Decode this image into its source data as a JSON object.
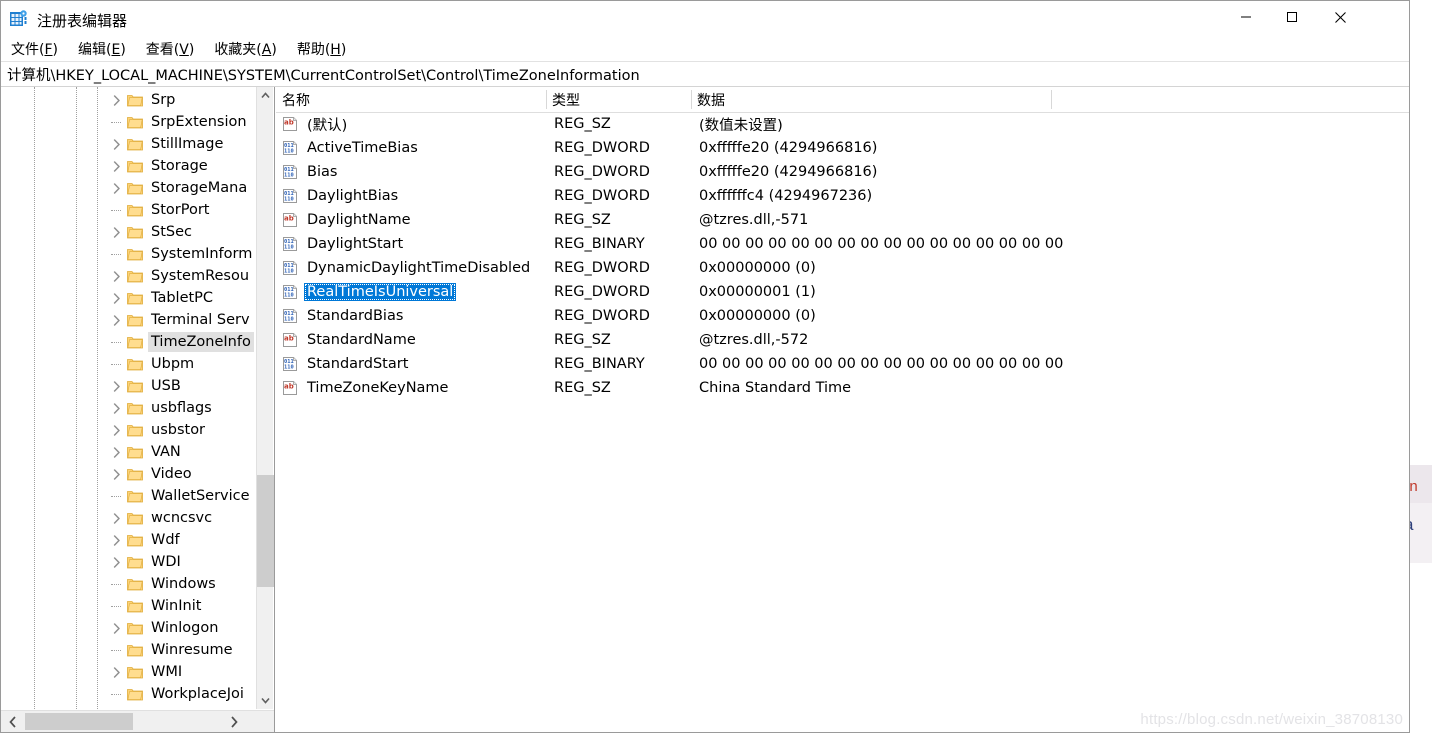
{
  "window": {
    "title": "注册表编辑器",
    "icon": "registry-icon",
    "controls": {
      "minimize": "—",
      "maximize": "□",
      "close": "✕"
    }
  },
  "menu": {
    "items": [
      {
        "label": "文件(F)",
        "text": "文件(",
        "accel": "F",
        "tail": ")"
      },
      {
        "label": "编辑(E)",
        "text": "编辑(",
        "accel": "E",
        "tail": ")"
      },
      {
        "label": "查看(V)",
        "text": "查看(",
        "accel": "V",
        "tail": ")"
      },
      {
        "label": "收藏夹(A)",
        "text": "收藏夹(",
        "accel": "A",
        "tail": ")"
      },
      {
        "label": "帮助(H)",
        "text": "帮助(",
        "accel": "H",
        "tail": ")"
      }
    ]
  },
  "address": {
    "path": "计算机\\HKEY_LOCAL_MACHINE\\SYSTEM\\CurrentControlSet\\Control\\TimeZoneInformation"
  },
  "tree": {
    "selected": "TimeZoneInfo",
    "items": [
      {
        "label": "Srp",
        "expandable": true,
        "selected": false
      },
      {
        "label": "SrpExtension",
        "expandable": false,
        "selected": false
      },
      {
        "label": "StillImage",
        "expandable": true,
        "selected": false
      },
      {
        "label": "Storage",
        "expandable": true,
        "selected": false
      },
      {
        "label": "StorageMana",
        "expandable": true,
        "selected": false
      },
      {
        "label": "StorPort",
        "expandable": false,
        "selected": false
      },
      {
        "label": "StSec",
        "expandable": true,
        "selected": false
      },
      {
        "label": "SystemInform",
        "expandable": false,
        "selected": false
      },
      {
        "label": "SystemResou",
        "expandable": true,
        "selected": false
      },
      {
        "label": "TabletPC",
        "expandable": true,
        "selected": false
      },
      {
        "label": "Terminal Serv",
        "expandable": true,
        "selected": false
      },
      {
        "label": "TimeZoneInfo",
        "expandable": false,
        "selected": true
      },
      {
        "label": "Ubpm",
        "expandable": false,
        "selected": false
      },
      {
        "label": "USB",
        "expandable": true,
        "selected": false
      },
      {
        "label": "usbflags",
        "expandable": true,
        "selected": false
      },
      {
        "label": "usbstor",
        "expandable": true,
        "selected": false
      },
      {
        "label": "VAN",
        "expandable": true,
        "selected": false
      },
      {
        "label": "Video",
        "expandable": true,
        "selected": false
      },
      {
        "label": "WalletService",
        "expandable": false,
        "selected": false
      },
      {
        "label": "wcncsvc",
        "expandable": true,
        "selected": false
      },
      {
        "label": "Wdf",
        "expandable": true,
        "selected": false
      },
      {
        "label": "WDI",
        "expandable": true,
        "selected": false
      },
      {
        "label": "Windows",
        "expandable": false,
        "selected": false
      },
      {
        "label": "WinInit",
        "expandable": false,
        "selected": false
      },
      {
        "label": "Winlogon",
        "expandable": true,
        "selected": false
      },
      {
        "label": "Winresume",
        "expandable": false,
        "selected": false
      },
      {
        "label": "WMI",
        "expandable": true,
        "selected": false
      },
      {
        "label": "WorkplaceJoi",
        "expandable": false,
        "selected": false
      }
    ]
  },
  "list": {
    "columns": [
      {
        "key": "name",
        "label": "名称"
      },
      {
        "key": "type",
        "label": "类型"
      },
      {
        "key": "data",
        "label": "数据"
      }
    ],
    "rows": [
      {
        "icon": "string-value-icon",
        "name": "(默认)",
        "type": "REG_SZ",
        "data": "(数值未设置)",
        "selected": false
      },
      {
        "icon": "dword-value-icon",
        "name": "ActiveTimeBias",
        "type": "REG_DWORD",
        "data": "0xfffffe20 (4294966816)",
        "selected": false
      },
      {
        "icon": "dword-value-icon",
        "name": "Bias",
        "type": "REG_DWORD",
        "data": "0xfffffe20 (4294966816)",
        "selected": false
      },
      {
        "icon": "dword-value-icon",
        "name": "DaylightBias",
        "type": "REG_DWORD",
        "data": "0xffffffc4 (4294967236)",
        "selected": false
      },
      {
        "icon": "string-value-icon",
        "name": "DaylightName",
        "type": "REG_SZ",
        "data": "@tzres.dll,-571",
        "selected": false
      },
      {
        "icon": "dword-value-icon",
        "name": "DaylightStart",
        "type": "REG_BINARY",
        "data": "00 00 00 00 00 00 00 00 00 00 00 00 00 00 00 00",
        "selected": false
      },
      {
        "icon": "dword-value-icon",
        "name": "DynamicDaylightTimeDisabled",
        "type": "REG_DWORD",
        "data": "0x00000000 (0)",
        "selected": false
      },
      {
        "icon": "dword-value-icon",
        "name": "RealTimeIsUniversal",
        "type": "REG_DWORD",
        "data": "0x00000001 (1)",
        "selected": true
      },
      {
        "icon": "dword-value-icon",
        "name": "StandardBias",
        "type": "REG_DWORD",
        "data": "0x00000000 (0)",
        "selected": false
      },
      {
        "icon": "string-value-icon",
        "name": "StandardName",
        "type": "REG_SZ",
        "data": "@tzres.dll,-572",
        "selected": false
      },
      {
        "icon": "dword-value-icon",
        "name": "StandardStart",
        "type": "REG_BINARY",
        "data": "00 00 00 00 00 00 00 00 00 00 00 00 00 00 00 00",
        "selected": false
      },
      {
        "icon": "string-value-icon",
        "name": "TimeZoneKeyName",
        "type": "REG_SZ",
        "data": "China Standard Time",
        "selected": false
      }
    ]
  },
  "watermark": {
    "text": "https://blog.csdn.net/weixin_38708130"
  },
  "bleed": {
    "fragment_top": "on",
    "fragment_bottom": "a"
  },
  "colors": {
    "selection_blue": "#0078d7",
    "tree_selection_gray": "#e0e0e0",
    "folder_yellow": "#ffd26b",
    "scrollbar_thumb": "#cdcdcd",
    "scrollbar_track": "#f0f0f0"
  }
}
